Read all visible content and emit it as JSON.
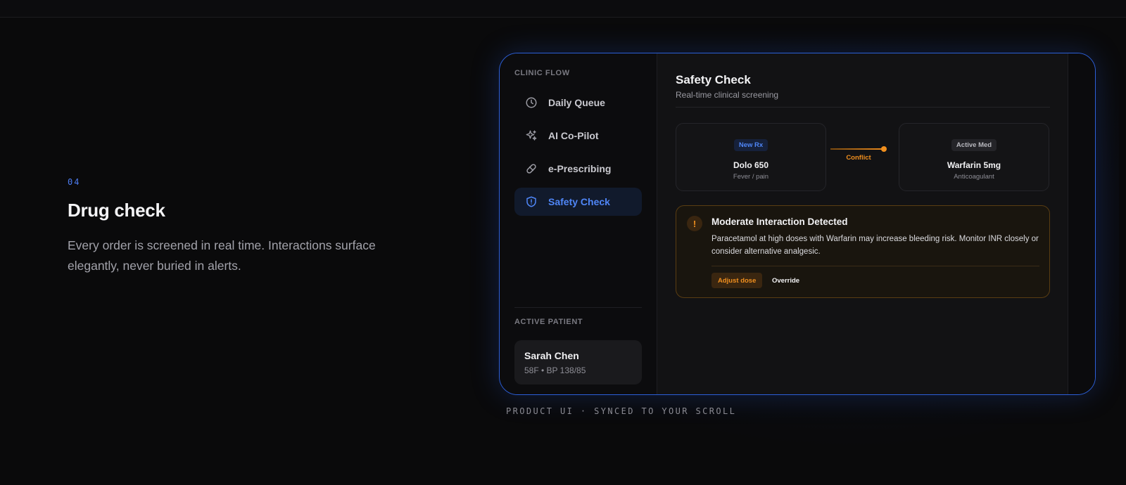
{
  "section": {
    "step": "04",
    "headline": "Drug check",
    "body": "Every order is screened in real time. Interactions surface elegantly, never buried in alerts."
  },
  "sidebar": {
    "section_label": "CLINIC FLOW",
    "items": [
      {
        "label": "Daily Queue",
        "icon": "clock-icon"
      },
      {
        "label": "AI Co-Pilot",
        "icon": "sparkle-icon"
      },
      {
        "label": "e-Prescribing",
        "icon": "pill-icon"
      },
      {
        "label": "Safety Check",
        "icon": "shield-icon",
        "active": true
      }
    ],
    "patient_label": "ACTIVE PATIENT",
    "patient": {
      "name": "Sarah Chen",
      "meta": "58F • BP 138/85"
    }
  },
  "main": {
    "title": "Safety Check",
    "subtitle": "Real-time clinical screening",
    "new_rx": {
      "badge": "New Rx",
      "name": "Dolo 650",
      "desc": "Fever / pain"
    },
    "conflict_label": "Conflict",
    "active_med": {
      "badge": "Active Med",
      "name": "Warfarin 5mg",
      "desc": "Anticoagulant"
    },
    "alert": {
      "icon_glyph": "!",
      "title": "Moderate Interaction Detected",
      "text": "Paracetamol at high doses with Warfarin may increase bleeding risk. Monitor INR closely or consider alternative analgesic.",
      "primary_action": "Adjust dose",
      "secondary_action": "Override"
    }
  },
  "caption": "PRODUCT UI · SYNCED TO YOUR SCROLL",
  "colors": {
    "accent": "#4f86f7",
    "warning": "#f08f1e",
    "frame_border": "#2c5fd8",
    "background": "#0a0a0b"
  }
}
